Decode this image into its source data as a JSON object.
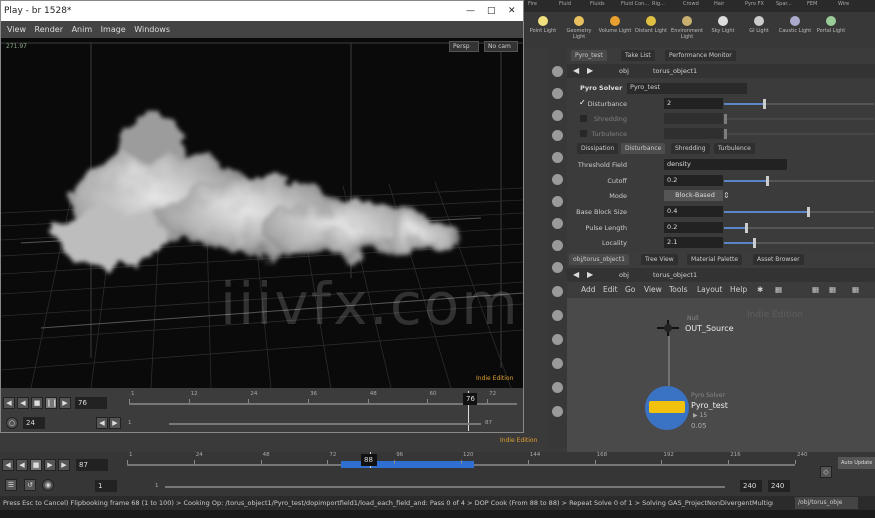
{
  "flipbook": {
    "title": "Play - br 1528*",
    "menu": [
      "View",
      "Render",
      "Anim",
      "Image",
      "Windows"
    ],
    "top_right_buttons": [
      "Persp",
      "No cam"
    ],
    "corner_label": "Indie Edition",
    "frame_value": "76",
    "current_frame": "76",
    "start_frame": "1",
    "end_frame": "87",
    "fps": "24",
    "tick_labels": [
      "1",
      "12",
      "24",
      "36",
      "48",
      "60",
      "72"
    ]
  },
  "shelf": {
    "tabs": [
      "Fire",
      "Fluid",
      "Fluids",
      "Fluid Con...",
      "Rig...",
      "Crowd",
      "Hair",
      "Pyro FX",
      "Spar...",
      "FEM",
      "Wire"
    ],
    "tools": [
      "Point Light",
      "Geometry Light",
      "Volume Light",
      "Distant Light",
      "Environment Light",
      "Sky Light",
      "GI Light",
      "Caustic Light",
      "Portal Light"
    ]
  },
  "param_pane": {
    "tabs": [
      "Pyro_test",
      "Take List",
      "Performance Monitor"
    ],
    "path": "obj",
    "node_path": "torus_object1",
    "node_type": "Pyro Solver",
    "node_name": "Pyro_test",
    "top_params": [
      {
        "label": "Disturbance",
        "value": "2",
        "fill": 0.26
      },
      {
        "label": "Shredding",
        "value": "",
        "fill": 0.0
      },
      {
        "label": "Turbulence",
        "value": "",
        "fill": 0.0
      }
    ],
    "sub_tabs": [
      "Dissipation",
      "Disturbance",
      "Shredding",
      "Turbulence"
    ],
    "threshold_field_label": "Threshold Field",
    "threshold_field_value": "density",
    "cutoff_label": "Cutoff",
    "cutoff_value": "0.2",
    "cutoff_fill": 0.28,
    "mode_label": "Mode",
    "mode_value": "Block-Based",
    "params": [
      {
        "label": "Base Block Size",
        "value": "0.4",
        "fill": 0.55
      },
      {
        "label": "Pulse Length",
        "value": "0.2",
        "fill": 0.14
      },
      {
        "label": "Locality",
        "value": "2.1",
        "fill": 0.19
      }
    ]
  },
  "network": {
    "tabs": [
      "obj/torus_object1",
      "Tree View",
      "Material Palette",
      "Asset Browser"
    ],
    "path": "obj",
    "node_path": "torus_object1",
    "menu": [
      "Add",
      "Edit",
      "Go",
      "View",
      "Tools",
      "Layout",
      "Help"
    ],
    "edition_label": "Indie Edition",
    "nodes": [
      {
        "type": "Null",
        "name": "OUT_Source"
      },
      {
        "type": "Pyro Solver",
        "name": "Pyro_test",
        "info": [
          "▶ 15",
          "0.05"
        ]
      }
    ]
  },
  "main_timeline": {
    "frame_value": "87",
    "current_frame": "88",
    "start_frame": "1",
    "range_start": "1",
    "range_end": "240",
    "end_frame": "240",
    "corner_label": "Indie Edition",
    "tick_labels": [
      "1",
      "24",
      "48",
      "72",
      "96",
      "120",
      "144",
      "168",
      "192",
      "216",
      "240"
    ],
    "cached_fraction": [
      0.32,
      0.52
    ],
    "auto_update_label": "Auto Update"
  },
  "status_text": "Press Esc to Cancel) Flipbooking frame 68 (1 to 100) > Cooking Op: /torus_object1/Pyro_test/dopimportfield1/load_each_field_and: Pass 0 of 4 > DOP Cook (From 88 to 88) > Repeat Solve 0 of 1 > Solving GAS_ProjectNonDivergentMultigrid / /obj/t...",
  "status_right": "/obj/torus_obje",
  "watermark": "iiivfx.com",
  "colors": {
    "accent": "#5a86c8",
    "cache_bar": "#2e6fd1",
    "node_pyro": "#f2c10c",
    "node_ring": "#3b73c4"
  }
}
